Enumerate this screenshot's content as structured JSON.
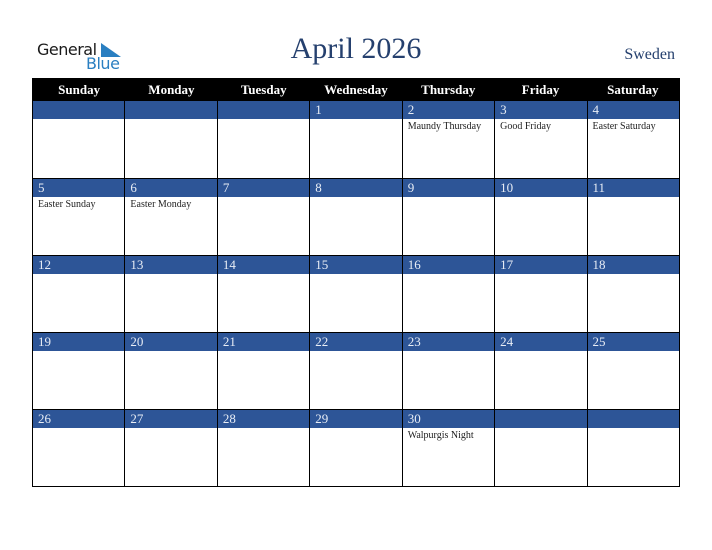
{
  "logo": {
    "word1": "General",
    "word2": "Blue",
    "accent_color": "#2a7fc1"
  },
  "header": {
    "title": "April 2026",
    "country": "Sweden"
  },
  "colors": {
    "header_bg": "#000000",
    "date_band": "#2d5597",
    "title": "#25406e"
  },
  "weekdays": [
    "Sunday",
    "Monday",
    "Tuesday",
    "Wednesday",
    "Thursday",
    "Friday",
    "Saturday"
  ],
  "weeks": [
    [
      {
        "day": "",
        "holiday": ""
      },
      {
        "day": "",
        "holiday": ""
      },
      {
        "day": "",
        "holiday": ""
      },
      {
        "day": "1",
        "holiday": ""
      },
      {
        "day": "2",
        "holiday": "Maundy Thursday"
      },
      {
        "day": "3",
        "holiday": "Good Friday"
      },
      {
        "day": "4",
        "holiday": "Easter Saturday"
      }
    ],
    [
      {
        "day": "5",
        "holiday": "Easter Sunday"
      },
      {
        "day": "6",
        "holiday": "Easter Monday"
      },
      {
        "day": "7",
        "holiday": ""
      },
      {
        "day": "8",
        "holiday": ""
      },
      {
        "day": "9",
        "holiday": ""
      },
      {
        "day": "10",
        "holiday": ""
      },
      {
        "day": "11",
        "holiday": ""
      }
    ],
    [
      {
        "day": "12",
        "holiday": ""
      },
      {
        "day": "13",
        "holiday": ""
      },
      {
        "day": "14",
        "holiday": ""
      },
      {
        "day": "15",
        "holiday": ""
      },
      {
        "day": "16",
        "holiday": ""
      },
      {
        "day": "17",
        "holiday": ""
      },
      {
        "day": "18",
        "holiday": ""
      }
    ],
    [
      {
        "day": "19",
        "holiday": ""
      },
      {
        "day": "20",
        "holiday": ""
      },
      {
        "day": "21",
        "holiday": ""
      },
      {
        "day": "22",
        "holiday": ""
      },
      {
        "day": "23",
        "holiday": ""
      },
      {
        "day": "24",
        "holiday": ""
      },
      {
        "day": "25",
        "holiday": ""
      }
    ],
    [
      {
        "day": "26",
        "holiday": ""
      },
      {
        "day": "27",
        "holiday": ""
      },
      {
        "day": "28",
        "holiday": ""
      },
      {
        "day": "29",
        "holiday": ""
      },
      {
        "day": "30",
        "holiday": "Walpurgis Night"
      },
      {
        "day": "",
        "holiday": ""
      },
      {
        "day": "",
        "holiday": ""
      }
    ]
  ]
}
